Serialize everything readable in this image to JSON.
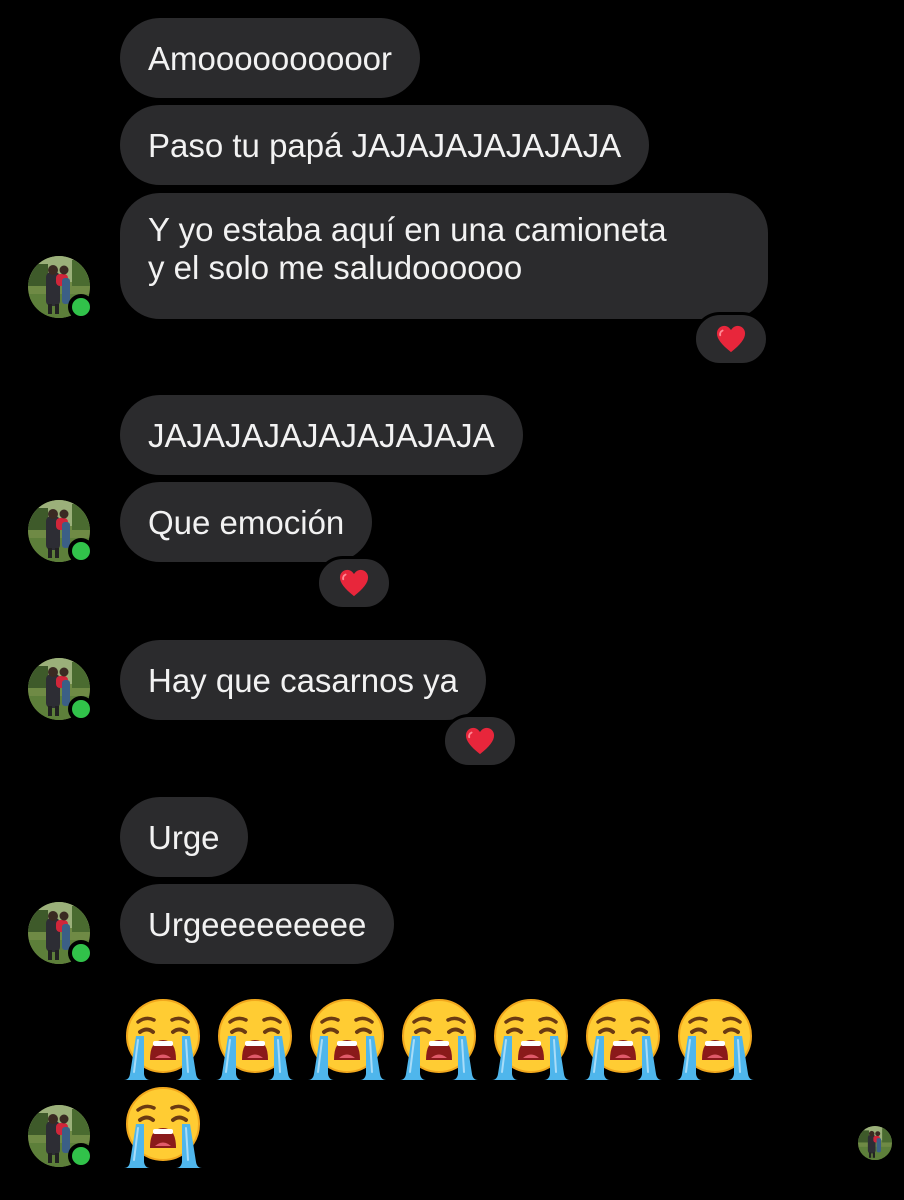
{
  "messages": {
    "m1": "Amoooooooooor",
    "m2": "Paso tu papá JAJAJAJAJAJAJA",
    "m3_line1": "Y yo estaba aquí en una camioneta",
    "m3_line2": "y el solo me saludoooooo",
    "m4": "JAJAJAJAJAJAJAJAJA",
    "m5": "Que emoción",
    "m6": "Hay que casarnos ya",
    "m7": "Urge",
    "m8": "Urgeeeeeeeee"
  },
  "reactions": {
    "icon": "red-heart",
    "color": "#e8263b"
  },
  "emoji": {
    "name": "loudly-crying-face",
    "count": 8
  },
  "colors": {
    "background": "#000000",
    "bubble": "#2b2b2d",
    "text": "#f2f2f2",
    "online": "#31c24a"
  }
}
